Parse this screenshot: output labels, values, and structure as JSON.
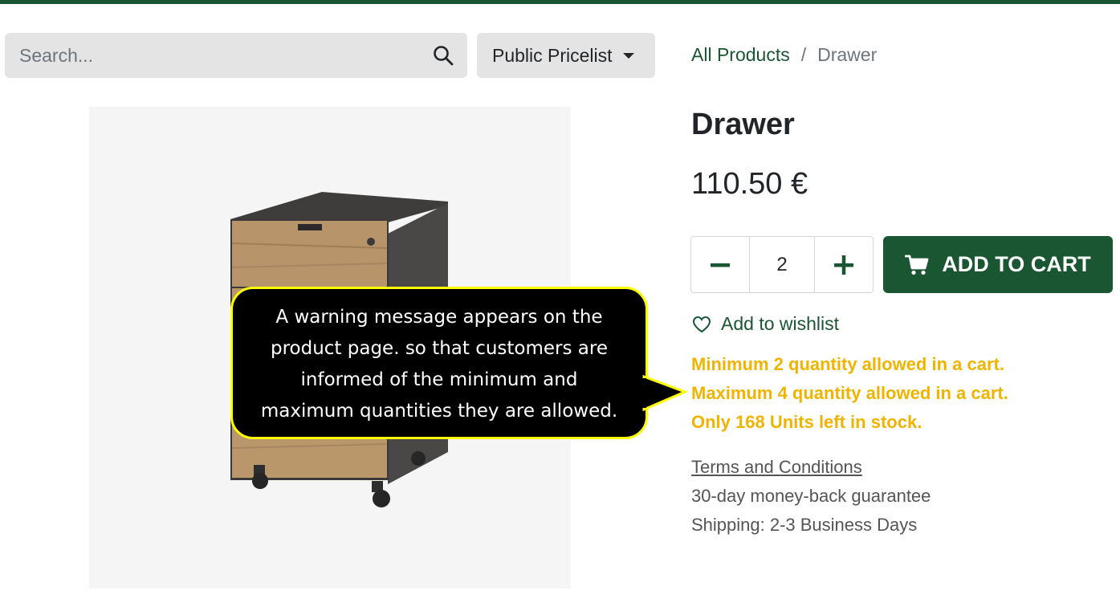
{
  "search": {
    "placeholder": "Search..."
  },
  "pricelist": {
    "label": "Public Pricelist"
  },
  "breadcrumb": {
    "parent": "All Products",
    "separator": "/",
    "current": "Drawer"
  },
  "product": {
    "title": "Drawer",
    "price": "110.50 €",
    "quantity": "2",
    "add_to_cart_label": "ADD TO CART",
    "wishlist_label": "Add to wishlist"
  },
  "warnings": [
    "Minimum 2 quantity allowed in a cart.",
    "Maximum 4 quantity allowed in a cart.",
    "Only 168 Units left in stock."
  ],
  "info": {
    "terms_label": "Terms and Conditions",
    "guarantee": "30-day money-back guarantee",
    "shipping": "Shipping: 2-3 Business Days"
  },
  "callout": {
    "lines": [
      "A warning message appears on the",
      "product page. so that customers are",
      "informed of the minimum and",
      "maximum quantities they are allowed."
    ]
  },
  "icons": {
    "search": "search-icon",
    "caret": "caret-down-icon",
    "minus": "minus-icon",
    "plus": "plus-icon",
    "cart": "cart-icon",
    "heart": "heart-icon"
  },
  "colors": {
    "brand": "#1a5632",
    "warning": "#f0b400",
    "callout_border": "#ffff00",
    "callout_bg": "#000000"
  }
}
